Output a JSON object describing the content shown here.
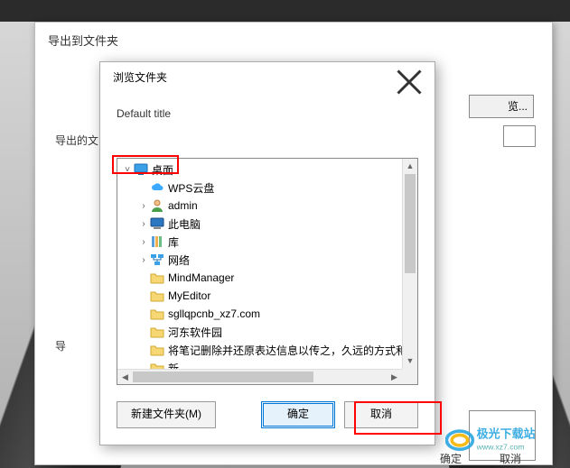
{
  "parent_dialog": {
    "title": "导出到文件夹",
    "label_export_path": "导出的文",
    "label_export2": "导",
    "browse_label": "览...",
    "bottom_ok": "确定",
    "bottom_cancel": "取消"
  },
  "folder_dialog": {
    "title": "浏览文件夹",
    "subtitle": "Default title",
    "new_folder_label": "新建文件夹(M)",
    "ok_label": "确定",
    "cancel_label": "取消"
  },
  "tree": {
    "items": [
      {
        "label": "桌面",
        "indent": 0,
        "exp": "v",
        "icon": "desktop-icon"
      },
      {
        "label": "WPS云盘",
        "indent": 1,
        "exp": "",
        "icon": "wps-cloud-icon"
      },
      {
        "label": "admin",
        "indent": 1,
        "exp": ">",
        "icon": "user-icon"
      },
      {
        "label": "此电脑",
        "indent": 1,
        "exp": ">",
        "icon": "this-pc-icon"
      },
      {
        "label": "库",
        "indent": 1,
        "exp": ">",
        "icon": "libraries-icon"
      },
      {
        "label": "网络",
        "indent": 1,
        "exp": ">",
        "icon": "network-icon"
      },
      {
        "label": "MindManager",
        "indent": 1,
        "exp": "",
        "icon": "folder-icon"
      },
      {
        "label": "MyEditor",
        "indent": 1,
        "exp": "",
        "icon": "folder-icon"
      },
      {
        "label": "sgllqpcnb_xz7.com",
        "indent": 1,
        "exp": "",
        "icon": "folder-icon"
      },
      {
        "label": "河东软件园",
        "indent": 1,
        "exp": "",
        "icon": "folder-icon"
      },
      {
        "label": "将笔记删除并还原表达信息以传之，久远的方式和工",
        "indent": 1,
        "exp": "",
        "icon": "folder-icon"
      },
      {
        "label": "新",
        "indent": 1,
        "exp": "",
        "icon": "folder-icon"
      }
    ]
  },
  "watermark": {
    "text": "极光下载站",
    "url": "www.xz7.com"
  }
}
